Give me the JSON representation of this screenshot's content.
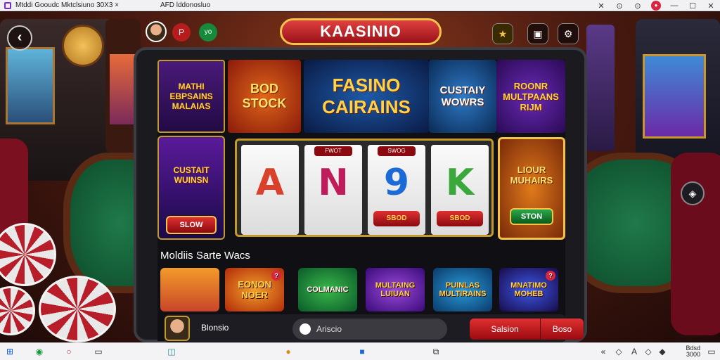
{
  "titlebar": {
    "tab1_label": "Mtddi Gooudc Mktclsiuno",
    "tab1_suffix": "30X3 ×",
    "tab2_label": "AFD lddonosluo",
    "min_icon": "—",
    "max_icon": "☐",
    "close_icon": "✕",
    "controls": [
      "✕",
      "⊙",
      "⊙"
    ]
  },
  "top": {
    "logo_text": "KAASINIO",
    "back_icon": "‹",
    "red_pill": "P",
    "green_pill": "yo",
    "star_icon": "★",
    "gift_icon": "▣",
    "settings_icon": "⚙"
  },
  "banners": [
    {
      "text": "MATHI EBPSAINS MALAIAS"
    },
    {
      "text": "BOD STOCK"
    },
    {
      "text": "FASINO CAIRAINS"
    },
    {
      "text": "CUSTAIY WOWRS"
    },
    {
      "text": "ROONR MULTPAANS RIJM"
    }
  ],
  "promo_left": {
    "title": "CUSTAIT WUINSN",
    "button": "SLOW"
  },
  "reels": [
    {
      "tag": "",
      "symbol": "A",
      "label": "",
      "color": "#d9412a"
    },
    {
      "tag": "FWOT",
      "symbol": "N",
      "label": "",
      "color": "#c01b5a"
    },
    {
      "tag": "SWOG",
      "symbol": "9",
      "label": "SBOD",
      "color": "#1a6ad8"
    },
    {
      "tag": "",
      "symbol": "K",
      "label": "SBOD",
      "color": "#3aa83a"
    }
  ],
  "promo_right": {
    "title": "LIOUR MUHAIRS",
    "button": "STON"
  },
  "section_title": "Moldiis Sarte Wacs",
  "thumbs": [
    {
      "text": "",
      "badge": ""
    },
    {
      "text": "EONON NOER",
      "badge": "?"
    },
    {
      "text": "COLMANIC",
      "badge": ""
    },
    {
      "text": "MULTAING LUIUAN",
      "badge": ""
    },
    {
      "text": "PUINLAS MULTIRAINS",
      "badge": ""
    },
    {
      "text": "MNATIMO MOHEB",
      "badge": "?"
    }
  ],
  "bottom_bar": {
    "username": "Blonsio",
    "search_placeholder": "Ariscio",
    "button_a": "Salsion",
    "button_b": "Boso"
  },
  "side_icon": "◈",
  "taskbar": {
    "start_icon": "⊞",
    "tray_text_1": "Bdsd",
    "tray_text_2": "3000"
  }
}
